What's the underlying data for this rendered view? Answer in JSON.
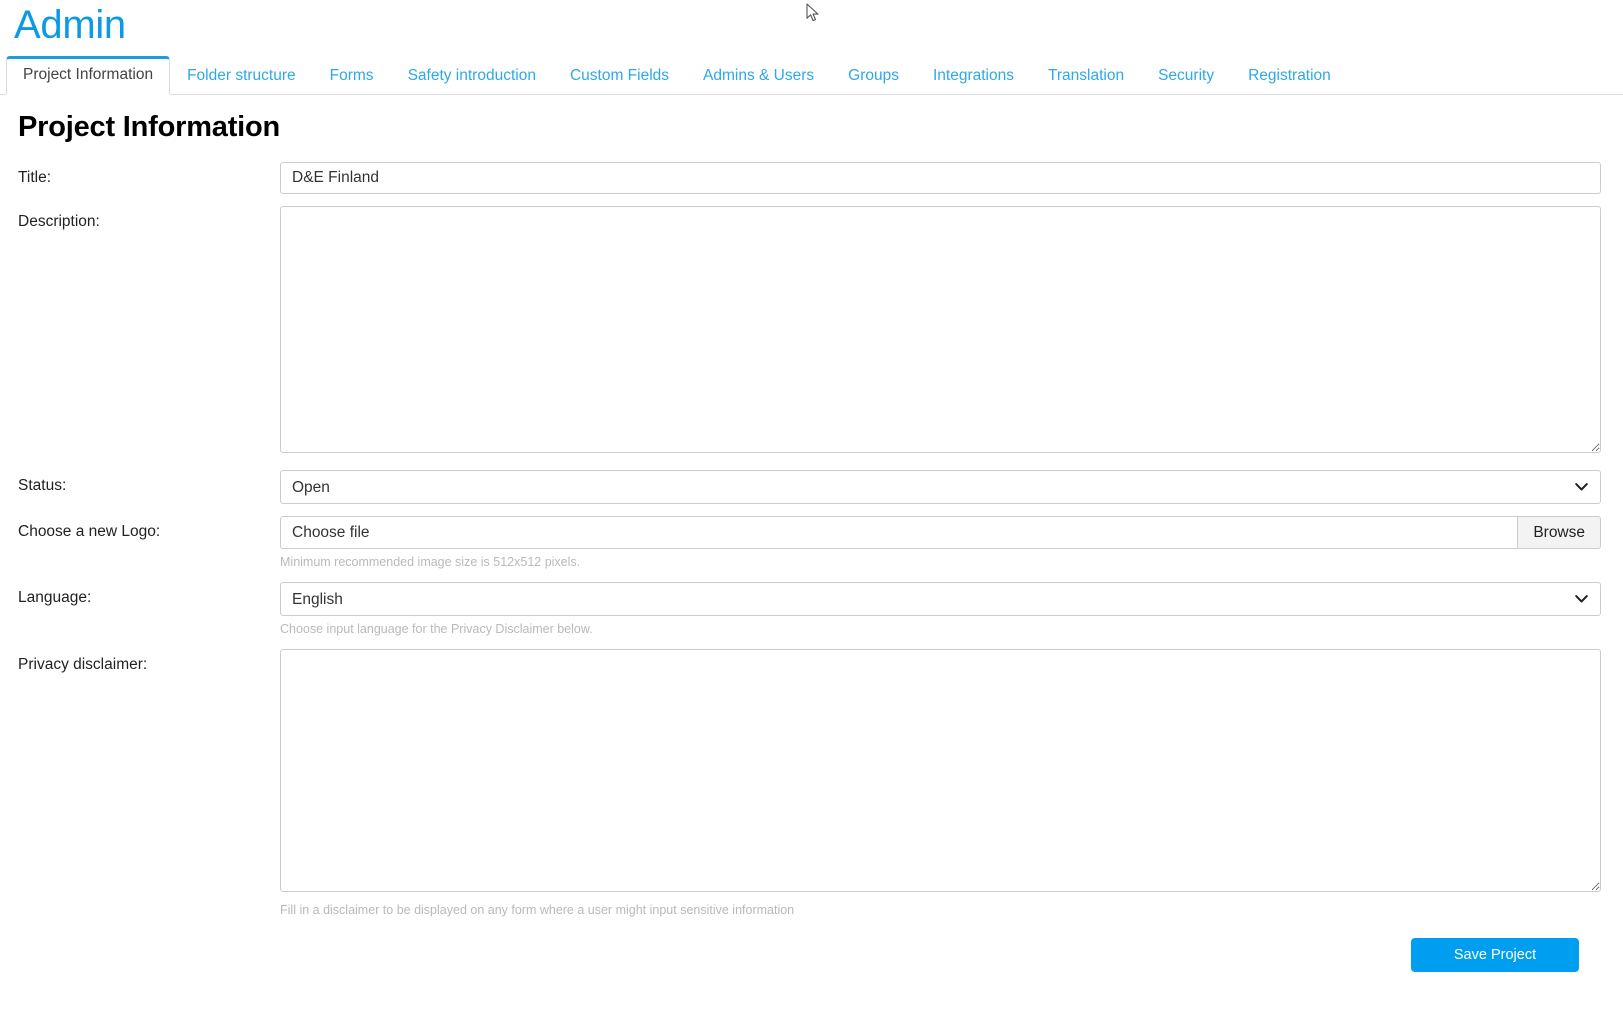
{
  "header": {
    "app_title": "Admin",
    "accent_color": "#0c9ae5"
  },
  "tabs": [
    {
      "label": "Project Information",
      "active": true
    },
    {
      "label": "Folder structure",
      "active": false
    },
    {
      "label": "Forms",
      "active": false
    },
    {
      "label": "Safety introduction",
      "active": false
    },
    {
      "label": "Custom Fields",
      "active": false
    },
    {
      "label": "Admins & Users",
      "active": false
    },
    {
      "label": "Groups",
      "active": false
    },
    {
      "label": "Integrations",
      "active": false
    },
    {
      "label": "Translation",
      "active": false
    },
    {
      "label": "Security",
      "active": false
    },
    {
      "label": "Registration",
      "active": false
    }
  ],
  "page": {
    "title": "Project Information"
  },
  "form": {
    "title": {
      "label": "Title:",
      "value": "D&E Finland",
      "placeholder": ""
    },
    "description": {
      "label": "Description:",
      "value": "",
      "placeholder": ""
    },
    "status": {
      "label": "Status:",
      "value": "Open",
      "options": [
        "Open"
      ]
    },
    "logo": {
      "label": "Choose a new Logo:",
      "file_text": "Choose file",
      "browse_label": "Browse",
      "help": "Minimum recommended image size is 512x512 pixels."
    },
    "language": {
      "label": "Language:",
      "value": "English",
      "options": [
        "English"
      ],
      "help": "Choose input language for the Privacy Disclaimer below."
    },
    "privacy_disclaimer": {
      "label": "Privacy disclaimer:",
      "value": "",
      "placeholder": "",
      "help": "Fill in a disclaimer to be displayed on any form where a user might input sensitive information"
    },
    "save_button": {
      "label": "Save Project",
      "color": "#009ef0"
    }
  }
}
